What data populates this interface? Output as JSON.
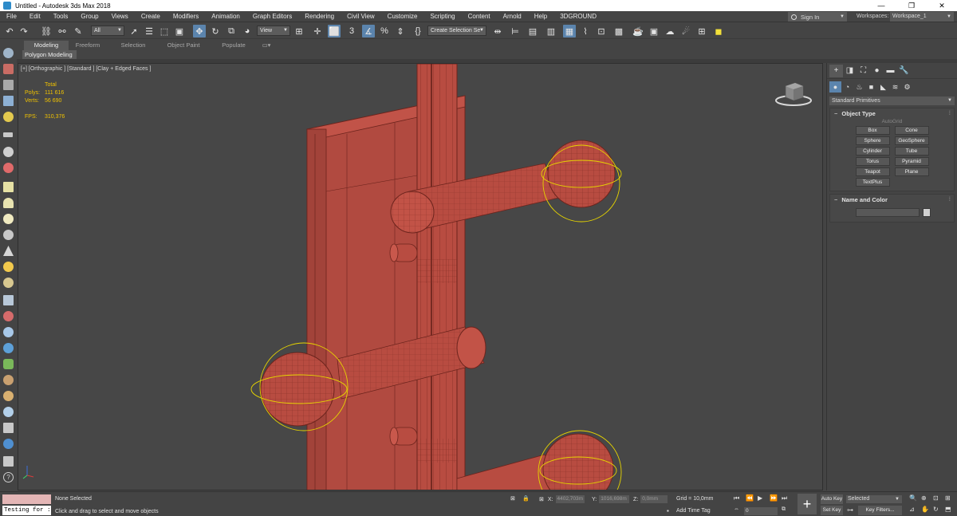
{
  "window": {
    "title": "Untitled - Autodesk 3ds Max 2018",
    "controls": [
      "—",
      "❐",
      "✕"
    ]
  },
  "menu": {
    "items": [
      "File",
      "Edit",
      "Tools",
      "Group",
      "Views",
      "Create",
      "Modifiers",
      "Animation",
      "Graph Editors",
      "Rendering",
      "Civil View",
      "Customize",
      "Scripting",
      "Content",
      "Arnold",
      "Help",
      "3DGROUND"
    ],
    "sign_in": "Sign In",
    "workspaces_label": "Workspaces:",
    "workspace_value": "Workspace_1"
  },
  "toolbar": {
    "selection_filter": "All",
    "reference_coord": "View",
    "named_selection": "Create Selection Se"
  },
  "ribbon": {
    "tabs": [
      "Modeling",
      "Freeform",
      "Selection",
      "Object Paint",
      "Populate"
    ],
    "active_tab": "Modeling",
    "sub_panel": "Polygon Modeling"
  },
  "viewport": {
    "label": "[+] [Orthographic ] [Standard ] [Clay + Edged Faces ]",
    "stats_total": "Total",
    "polys_label": "Polys:",
    "polys_value": "111 616",
    "verts_label": "Verts:",
    "verts_value": "56 690",
    "fps_label": "FPS:",
    "fps_value": "310,376",
    "model_color": "#b3473e",
    "selection_color": "#e6d400"
  },
  "command_panel": {
    "dropdown": "Standard Primitives",
    "object_type_title": "Object Type",
    "autogrid": "AutoGrid",
    "objects": [
      "Box",
      "Cone",
      "Sphere",
      "GeoSphere",
      "Cylinder",
      "Tube",
      "Torus",
      "Pyramid",
      "Teapot",
      "Plane",
      "TextPlus"
    ],
    "name_color_title": "Name and Color"
  },
  "status": {
    "script_listener": "Testing for :",
    "selection": "None Selected",
    "prompt": "Click and drag to select and move objects",
    "x_label": "X:",
    "x_value": "4402,703m",
    "y_label": "Y:",
    "y_value": "1016,698m",
    "z_label": "Z:",
    "z_value": "0,0mm",
    "grid": "Grid = 10,0mm",
    "add_time_tag": "Add Time Tag",
    "frame": "0",
    "auto_key": "Auto Key",
    "set_key": "Set Key",
    "key_mode": "Selected",
    "key_filters": "Key Filters..."
  }
}
